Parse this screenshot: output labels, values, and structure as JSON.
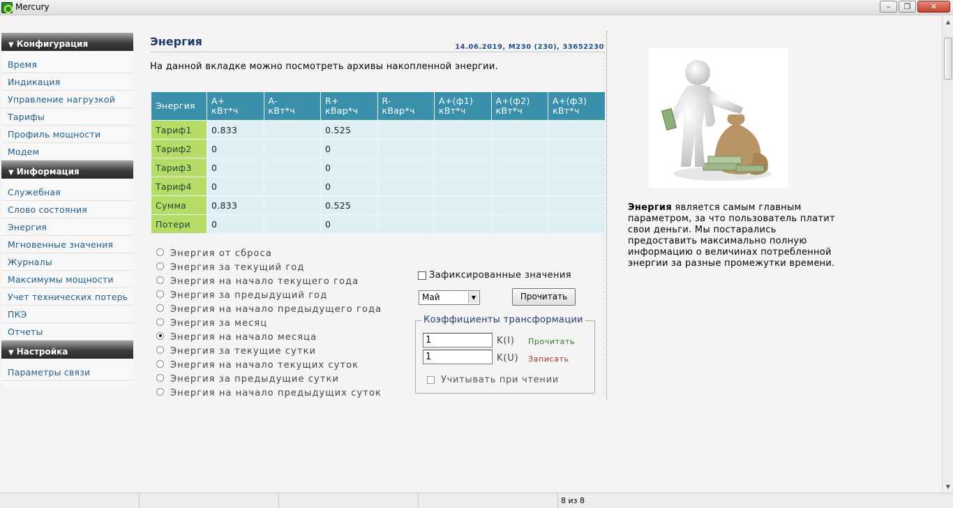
{
  "window": {
    "title": "Mercury"
  },
  "sidebar": {
    "sections": [
      {
        "title": "Конфигурация",
        "items": [
          "Время",
          "Индикация",
          "Управление нагрузкой",
          "Тарифы",
          "Профиль мощности",
          "Модем"
        ]
      },
      {
        "title": "Информация",
        "items": [
          "Служебная",
          "Слово состояния",
          "Энергия",
          "Мгновенные значения",
          "Журналы",
          "Максимумы мощности",
          "Учет технических потерь",
          "ПКЭ",
          "Отчеты"
        ]
      },
      {
        "title": "Настройка",
        "items": [
          "Параметры связи"
        ]
      }
    ]
  },
  "main": {
    "title": "Энергия",
    "meta": "14.06.2019, M230 (230), 33652230",
    "intro": "На данной вкладке можно посмотреть архивы накопленной энергии.",
    "table": {
      "headers": [
        [
          "Энергия",
          ""
        ],
        [
          "A+",
          "кВт*ч"
        ],
        [
          "A-",
          "кВт*ч"
        ],
        [
          "R+",
          "кВар*ч"
        ],
        [
          "R-",
          "кВар*ч"
        ],
        [
          "A+(ф1)",
          "кВт*ч"
        ],
        [
          "A+(ф2)",
          "кВт*ч"
        ],
        [
          "A+(ф3)",
          "кВт*ч"
        ]
      ],
      "rows": [
        [
          "Тариф1",
          "0.833",
          "",
          "0.525",
          "",
          "",
          "",
          ""
        ],
        [
          "Тариф2",
          "0",
          "",
          "0",
          "",
          "",
          "",
          ""
        ],
        [
          "Тариф3",
          "0",
          "",
          "0",
          "",
          "",
          "",
          ""
        ],
        [
          "Тариф4",
          "0",
          "",
          "0",
          "",
          "",
          "",
          ""
        ],
        [
          "Сумма",
          "0.833",
          "",
          "0.525",
          "",
          "",
          "",
          ""
        ],
        [
          "Потери",
          "0",
          "",
          "0",
          "",
          "",
          "",
          ""
        ]
      ]
    },
    "periods": [
      "Энергия от сброса",
      "Энергия за текущий год",
      "Энергия на начало текущего года",
      "Энергия за предыдущий год",
      "Энергия на начало предыдущего года",
      "Энергия за месяц",
      "Энергия на начало месяца",
      "Энергия за текущие сутки",
      "Энергия на начало текущих суток",
      "Энергия за предыдущие сутки",
      "Энергия на начало предыдущих суток"
    ],
    "selected_period_index": 6,
    "fixed_values_label": "Зафиксированные значения",
    "month_value": "Май",
    "read_button": "Прочитать",
    "coefficients": {
      "legend": "Коэффициенты трансформации",
      "ki_value": "1",
      "ku_value": "1",
      "ki_label": "K(I)",
      "ku_label": "K(U)",
      "read_link": "Прочитать",
      "write_link": "Записать",
      "apply_label": "Учитывать при чтении"
    }
  },
  "info": {
    "bold": "Энергия",
    "text": " является самым главным параметром, за что пользователь платит свои деньги. Мы постарались предоставить максимально полную информацию о величинах потребленной энергии за разные промежутки времени."
  },
  "statusbar": {
    "page": "8 из 8"
  },
  "colors": {
    "table_header": "#3a8fab",
    "table_cell": "#deeff6",
    "row_header": "#b4dc66",
    "title": "#1f3c6e",
    "link": "#1f5d8b"
  }
}
